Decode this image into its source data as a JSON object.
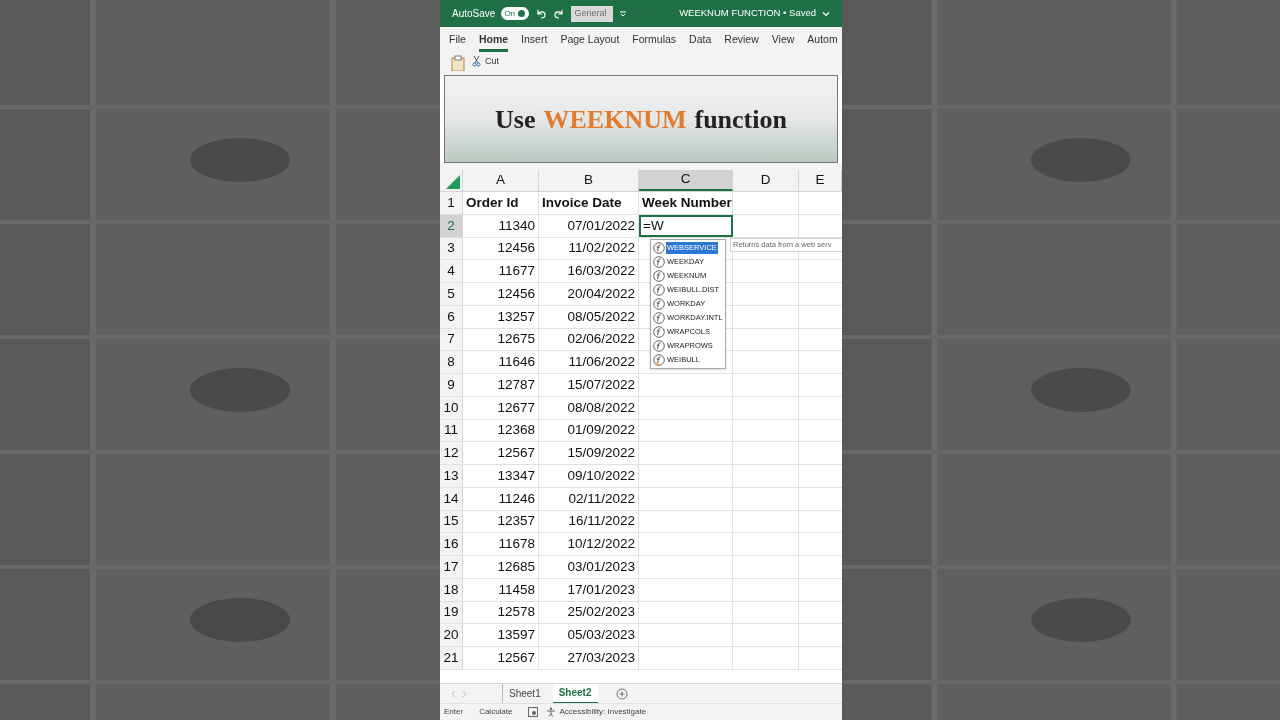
{
  "title_bar": {
    "autosave_label": "AutoSave",
    "autosave": {
      "label": "On",
      "on": true
    },
    "number_format": "General",
    "document_title": "WEEKNUM FUNCTION • Saved"
  },
  "ribbon_tabs": [
    {
      "label": "File",
      "selected": false
    },
    {
      "label": "Home",
      "selected": true
    },
    {
      "label": "Insert",
      "selected": false
    },
    {
      "label": "Page Layout",
      "selected": false
    },
    {
      "label": "Formulas",
      "selected": false
    },
    {
      "label": "Data",
      "selected": false
    },
    {
      "label": "Review",
      "selected": false
    },
    {
      "label": "View",
      "selected": false
    },
    {
      "label": "Autom",
      "selected": false
    }
  ],
  "ribbon": {
    "cut_label": "Cut"
  },
  "banner": {
    "before": "Use",
    "highlight": "WEEKNUM",
    "after": "function"
  },
  "columns": [
    {
      "label": "A",
      "selected": false
    },
    {
      "label": "B",
      "selected": false
    },
    {
      "label": "C",
      "selected": true
    },
    {
      "label": "D",
      "selected": false
    },
    {
      "label": "E",
      "selected": false
    }
  ],
  "header_row": {
    "number": "1",
    "cells": [
      "Order Id",
      "Invoice Date",
      "Week Number"
    ]
  },
  "rows": [
    {
      "number": "2",
      "order_id": "11340",
      "invoice_date": "07/01/2022",
      "selected": true,
      "editing": "=W"
    },
    {
      "number": "3",
      "order_id": "12456",
      "invoice_date": "11/02/2022",
      "selected": false
    },
    {
      "number": "4",
      "order_id": "11677",
      "invoice_date": "16/03/2022",
      "selected": false
    },
    {
      "number": "5",
      "order_id": "12456",
      "invoice_date": "20/04/2022",
      "selected": false
    },
    {
      "number": "6",
      "order_id": "13257",
      "invoice_date": "08/05/2022",
      "selected": false
    },
    {
      "number": "7",
      "order_id": "12675",
      "invoice_date": "02/06/2022",
      "selected": false
    },
    {
      "number": "8",
      "order_id": "11646",
      "invoice_date": "11/06/2022",
      "selected": false
    },
    {
      "number": "9",
      "order_id": "12787",
      "invoice_date": "15/07/2022",
      "selected": false
    },
    {
      "number": "10",
      "order_id": "12677",
      "invoice_date": "08/08/2022",
      "selected": false
    },
    {
      "number": "11",
      "order_id": "12368",
      "invoice_date": "01/09/2022",
      "selected": false
    },
    {
      "number": "12",
      "order_id": "12567",
      "invoice_date": "15/09/2022",
      "selected": false
    },
    {
      "number": "13",
      "order_id": "13347",
      "invoice_date": "09/10/2022",
      "selected": false
    },
    {
      "number": "14",
      "order_id": "11246",
      "invoice_date": "02/11/2022",
      "selected": false
    },
    {
      "number": "15",
      "order_id": "12357",
      "invoice_date": "16/11/2022",
      "selected": false
    },
    {
      "number": "16",
      "order_id": "11678",
      "invoice_date": "10/12/2022",
      "selected": false
    },
    {
      "number": "17",
      "order_id": "12685",
      "invoice_date": "03/01/2023",
      "selected": false
    },
    {
      "number": "18",
      "order_id": "11458",
      "invoice_date": "17/01/2023",
      "selected": false
    },
    {
      "number": "19",
      "order_id": "12578",
      "invoice_date": "25/02/2023",
      "selected": false
    },
    {
      "number": "20",
      "order_id": "13597",
      "invoice_date": "05/03/2023",
      "selected": false
    },
    {
      "number": "21",
      "order_id": "12567",
      "invoice_date": "27/03/2023",
      "selected": false
    }
  ],
  "autocomplete": {
    "items": [
      {
        "label": "WEBSERVICE",
        "kind": "function",
        "selected": true
      },
      {
        "label": "WEEKDAY",
        "kind": "function",
        "selected": false
      },
      {
        "label": "WEEKNUM",
        "kind": "function",
        "selected": false
      },
      {
        "label": "WEIBULL.DIST",
        "kind": "function",
        "selected": false
      },
      {
        "label": "WORKDAY",
        "kind": "function",
        "selected": false
      },
      {
        "label": "WORKDAY.INTL",
        "kind": "function",
        "selected": false
      },
      {
        "label": "WRAPCOLS",
        "kind": "function",
        "selected": false
      },
      {
        "label": "WRAPROWS",
        "kind": "function",
        "selected": false
      },
      {
        "label": "WEIBULL",
        "kind": "compatibility",
        "selected": false
      }
    ],
    "tooltip": "Returns data from a web serv"
  },
  "sheet_tabs": [
    {
      "label": "Sheet1",
      "selected": false
    },
    {
      "label": "Sheet2",
      "selected": true
    }
  ],
  "status_bar": {
    "mode": "Enter",
    "calculate": "Calculate",
    "accessibility": "Accessibility: Investigate"
  }
}
